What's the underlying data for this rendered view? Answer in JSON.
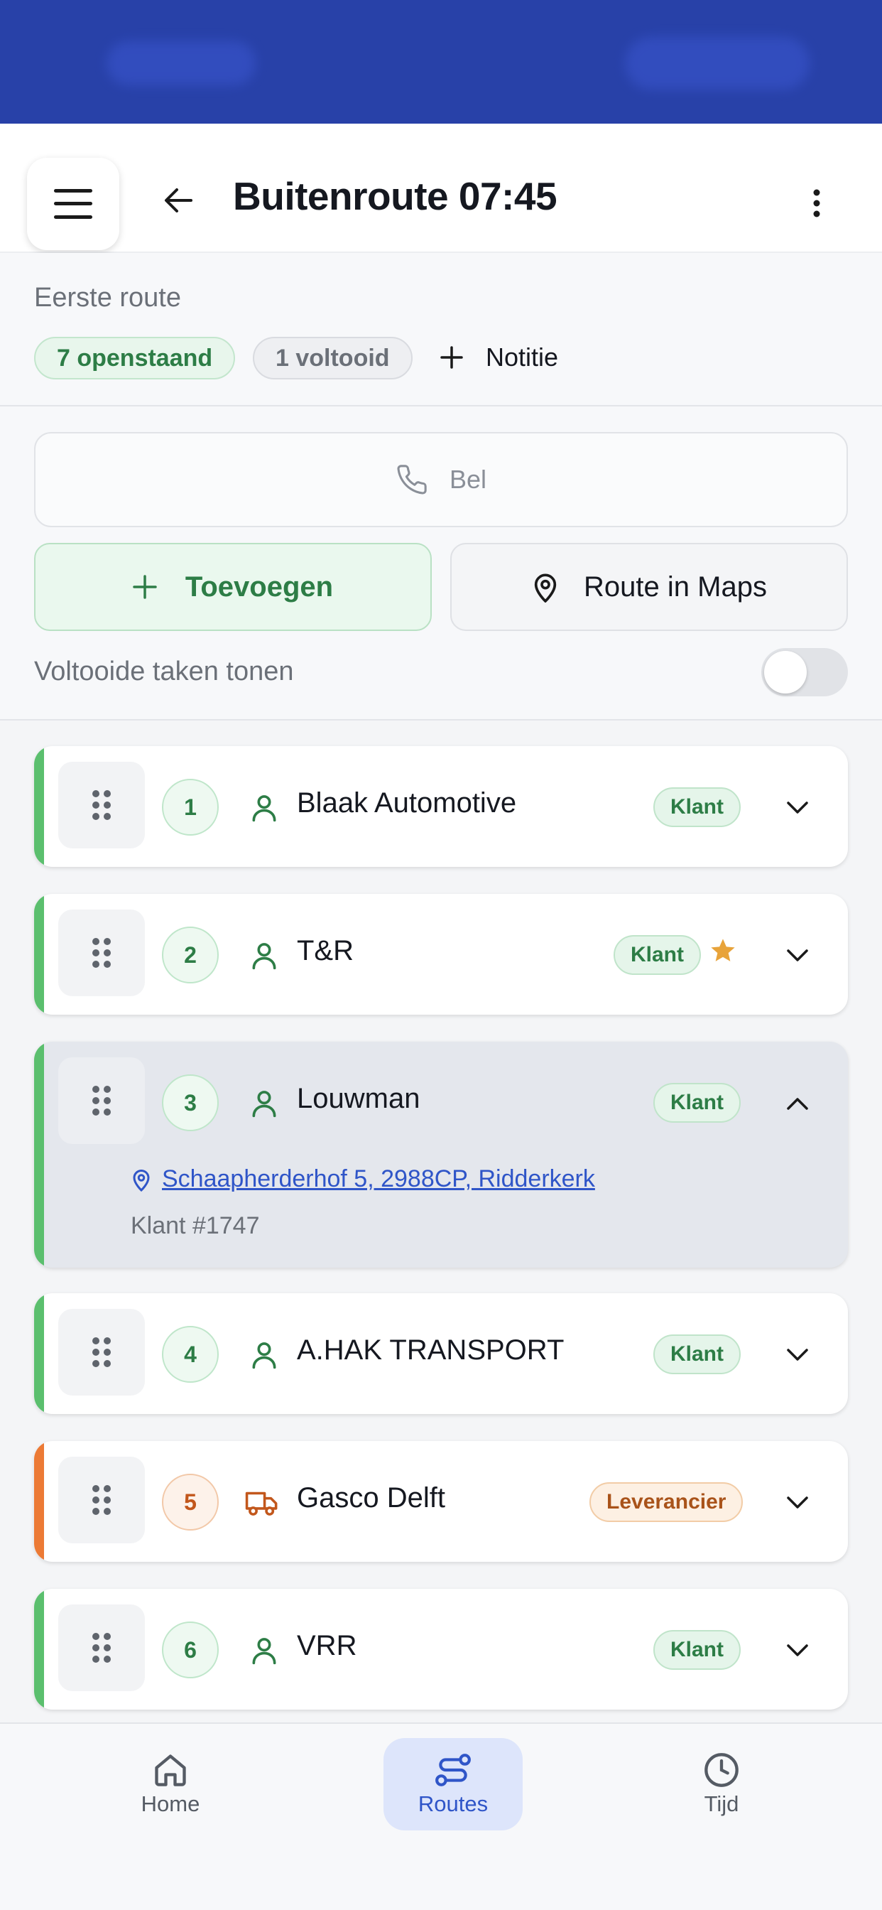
{
  "header": {
    "title": "Buitenroute 07:45"
  },
  "summary": {
    "subtitle": "Eerste route",
    "open_label": "7 openstaand",
    "done_label": "1 voltooid",
    "note_label": "Notitie"
  },
  "actions": {
    "call_label": "Bel",
    "add_label": "Toevoegen",
    "maps_label": "Route in Maps",
    "show_completed_label": "Voltooide taken tonen",
    "show_completed_on": false
  },
  "stops": [
    {
      "number": "1",
      "name": "Blaak Automotive",
      "badge": "Klant",
      "type": "customer",
      "icon": "person-icon",
      "expanded": false
    },
    {
      "number": "2",
      "name": "T&R",
      "badge": "Klant",
      "type": "customer",
      "icon": "person-icon",
      "starred": true,
      "expanded": false
    },
    {
      "number": "3",
      "name": "Louwman",
      "badge": "Klant",
      "type": "customer",
      "icon": "person-icon",
      "expanded": true,
      "address": "Schaapherderhof 5, 2988CP, Ridderkerk",
      "customer_number": "Klant #1747"
    },
    {
      "number": "4",
      "name": "A.HAK TRANSPORT",
      "badge": "Klant",
      "type": "customer",
      "icon": "person-icon",
      "expanded": false
    },
    {
      "number": "5",
      "name": "Gasco Delft",
      "badge": "Leverancier",
      "type": "supplier",
      "icon": "truck-icon",
      "expanded": false
    },
    {
      "number": "6",
      "name": "VRR",
      "badge": "Klant",
      "type": "customer",
      "icon": "person-icon",
      "expanded": false
    }
  ],
  "nav": {
    "home": "Home",
    "routes": "Routes",
    "time": "Tijd",
    "active": "routes"
  },
  "colors": {
    "status_bar": "#2841a8",
    "accent_green": "#2d7d46",
    "accent_orange": "#ec7a35",
    "accent_blue": "#2f55c8",
    "star": "#e8a33a"
  }
}
